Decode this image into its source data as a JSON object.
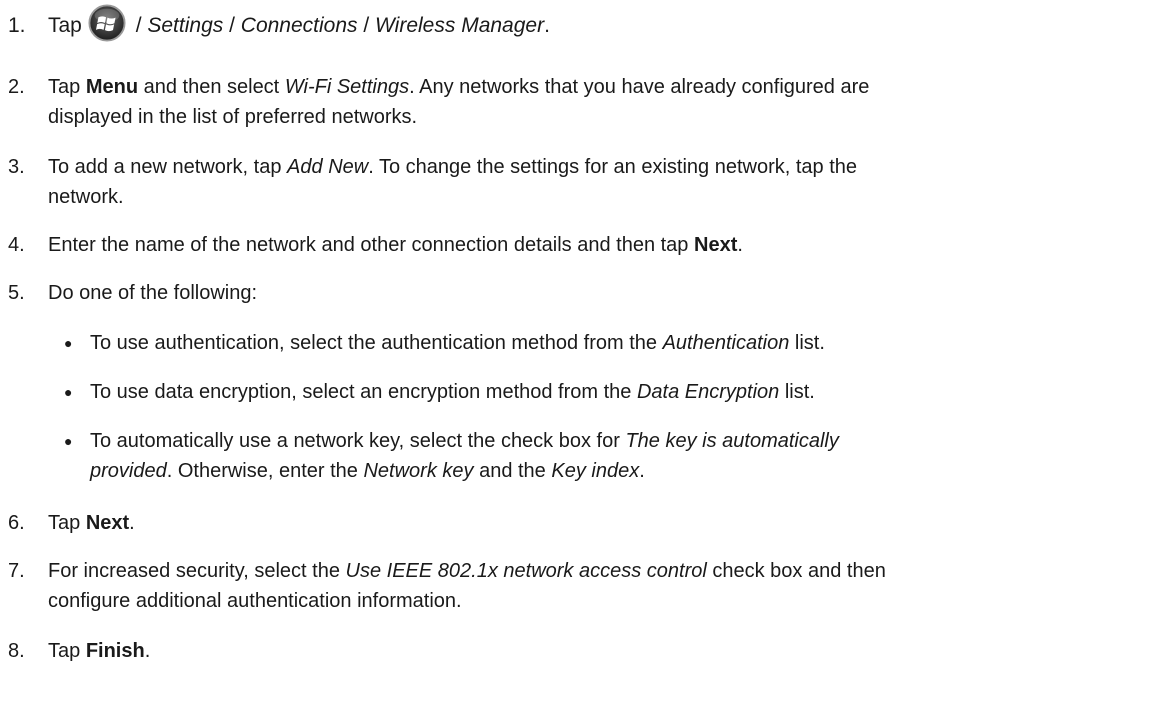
{
  "steps": [
    {
      "num": "1.",
      "before_icon": "Tap",
      "icon": "windows-start-icon",
      "path": [
        " / ",
        "Settings",
        " / ",
        "Connections",
        " / ",
        "Wireless Manager",
        "."
      ]
    },
    {
      "num": "2.",
      "t1": "Tap ",
      "b1": "Menu",
      "t2": " and then select ",
      "i1": "Wi-Fi Settings",
      "t3": ". Any networks that you have already configured are",
      "line2": "displayed in the list of preferred networks."
    },
    {
      "num": "3.",
      "t1": "To add a new network, tap ",
      "i1": "Add New",
      "t2": ". To change the settings for an existing network, tap the",
      "line2": "network."
    },
    {
      "num": "4.",
      "t1": "Enter the name of the network and other connection details and then tap ",
      "b1": "Next",
      "t2": "."
    },
    {
      "num": "5.",
      "text": "Do one of the following:",
      "bullets": [
        {
          "t1": "To use authentication, select the authentication method from the ",
          "i1": "Authentication",
          "t2": " list."
        },
        {
          "t1": "To use data encryption, select an encryption method from the ",
          "i1": "Data Encryption",
          "t2": " list."
        },
        {
          "t1": "To automatically use a network key, select the check box for ",
          "i1": "The key is automatically",
          "i2": "provided",
          "t2": ". Otherwise, enter the ",
          "i3": "Network key",
          "t3": " and the ",
          "i4": "Key index",
          "t4": "."
        }
      ]
    },
    {
      "num": "6.",
      "t1": "Tap ",
      "b1": "Next",
      "t2": "."
    },
    {
      "num": "7.",
      "t1": "For increased security, select the ",
      "i1": "Use IEEE 802.1x network access control",
      "t2": " check box and then",
      "line2": "configure additional authentication information."
    },
    {
      "num": "8.",
      "t1": "Tap ",
      "b1": "Finish",
      "t2": "."
    }
  ],
  "bullet_char": "●"
}
